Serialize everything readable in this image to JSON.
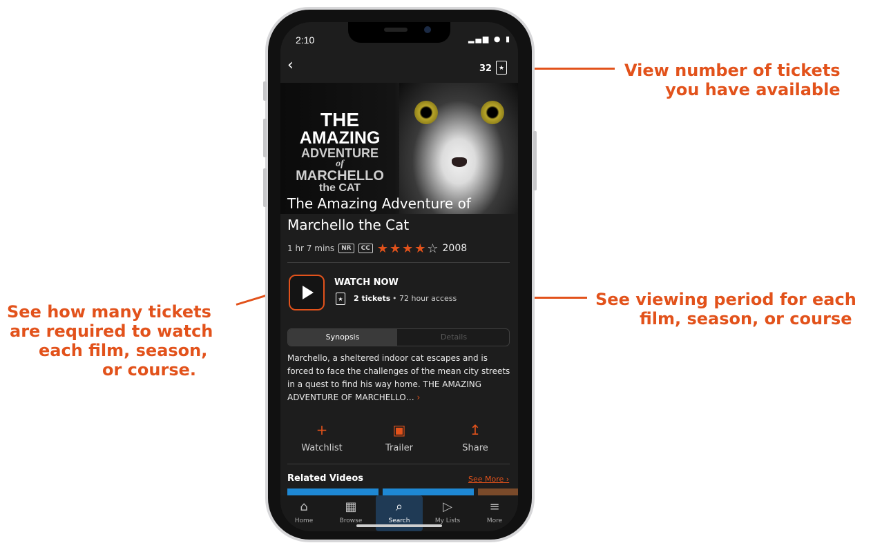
{
  "annotations": {
    "tickets_available": [
      "View number of tickets",
      "you have available"
    ],
    "tickets_required": [
      "See how many tickets",
      "are required to watch",
      "each film, season,",
      "or course."
    ],
    "viewing_period": [
      "See viewing period for each",
      "film, season, or course"
    ]
  },
  "status_bar": {
    "time": "2:10",
    "icons": "▂▄▆ ● ▮"
  },
  "header": {
    "back_icon": "chevron-left",
    "ticket_count": "32",
    "ticket_icon": "ticket-star-icon"
  },
  "poster": {
    "lines": [
      "THE",
      "AMAZING",
      "ADVENTURE",
      "of",
      "MARCHELLO",
      "the CAT"
    ]
  },
  "film": {
    "title": "The Amazing Adventure of Marchello the Cat",
    "duration": "1 hr 7 mins",
    "rating": "NR",
    "cc": "CC",
    "stars_filled": "★★★★",
    "stars_empty": "☆",
    "stars_value": 4,
    "year": "2008"
  },
  "watch": {
    "label": "WATCH NOW",
    "tickets": "2 tickets",
    "access": "• 72 hour access"
  },
  "segments": {
    "synopsis": "Synopsis",
    "details": "Details",
    "active": "Synopsis"
  },
  "synopsis_text": "Marchello, a sheltered indoor cat escapes and is forced to face the challenges of the mean city streets in a quest to find his way home. THE AMAZING ADVENTURE OF MARCHELLO…",
  "actions": [
    {
      "label": "Watchlist",
      "icon": "plus-icon",
      "glyph": "+"
    },
    {
      "label": "Trailer",
      "icon": "video-camera-icon",
      "glyph": "▣"
    },
    {
      "label": "Share",
      "icon": "share-icon",
      "glyph": "↥"
    }
  ],
  "related": {
    "title": "Related Videos",
    "see_more": "See More"
  },
  "tabs": [
    {
      "label": "Home",
      "icon": "home-icon",
      "glyph": "⌂"
    },
    {
      "label": "Browse",
      "icon": "film-icon",
      "glyph": "▦"
    },
    {
      "label": "Search",
      "icon": "search-icon",
      "glyph": "⌕"
    },
    {
      "label": "My Lists",
      "icon": "playlist-icon",
      "glyph": "▷"
    },
    {
      "label": "More",
      "icon": "menu-icon",
      "glyph": "≡"
    }
  ],
  "colors": {
    "accent": "#e2521b",
    "screen_bg": "#1d1d1d",
    "tab_active": "#1f3a55"
  }
}
